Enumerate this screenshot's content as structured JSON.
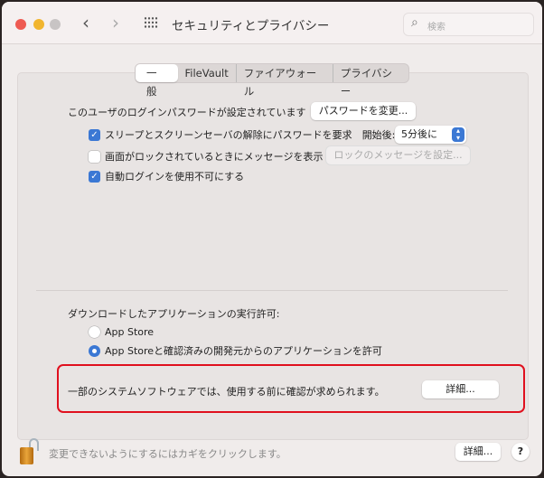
{
  "window": {
    "title": "セキュリティとプライバシー",
    "search_placeholder": "検索",
    "traffic_lights": {
      "close": "#ee5a52",
      "minimize": "#f1b52e",
      "zoom": "#c8c4c4"
    }
  },
  "tabs": [
    {
      "label": "一般",
      "selected": true
    },
    {
      "label": "FileVault",
      "selected": false
    },
    {
      "label": "ファイアウォール",
      "selected": false
    },
    {
      "label": "プライバシー",
      "selected": false
    }
  ],
  "general": {
    "password_text": "このユーザのログインパスワードが設定されています",
    "change_password_button": "パスワードを変更...",
    "require_password": {
      "label": "スリープとスクリーンセーバの解除にパスワードを要求",
      "checked": true,
      "start_label": "開始後:",
      "delay_value": "5分後に"
    },
    "lock_message": {
      "label": "画面がロックされているときにメッセージを表示",
      "checked": false,
      "button": "ロックのメッセージを設定..."
    },
    "disable_auto_login": {
      "label": "自動ログインを使用不可にする",
      "checked": true
    },
    "download_label": "ダウンロードしたアプリケーションの実行許可:",
    "download_options": [
      {
        "label": "App Store",
        "selected": false
      },
      {
        "label": "App Storeと確認済みの開発元からのアプリケーションを許可",
        "selected": true
      }
    ],
    "system_software_text": "一部のシステムソフトウェアでは、使用する前に確認が求められます。",
    "details_button": "詳細..."
  },
  "footer": {
    "lock_text": "変更できないようにするにはカギをクリックします。",
    "details_button": "詳細...",
    "help_button": "?"
  },
  "colors": {
    "accent": "#3b78d4",
    "highlight": "#e0101e"
  }
}
